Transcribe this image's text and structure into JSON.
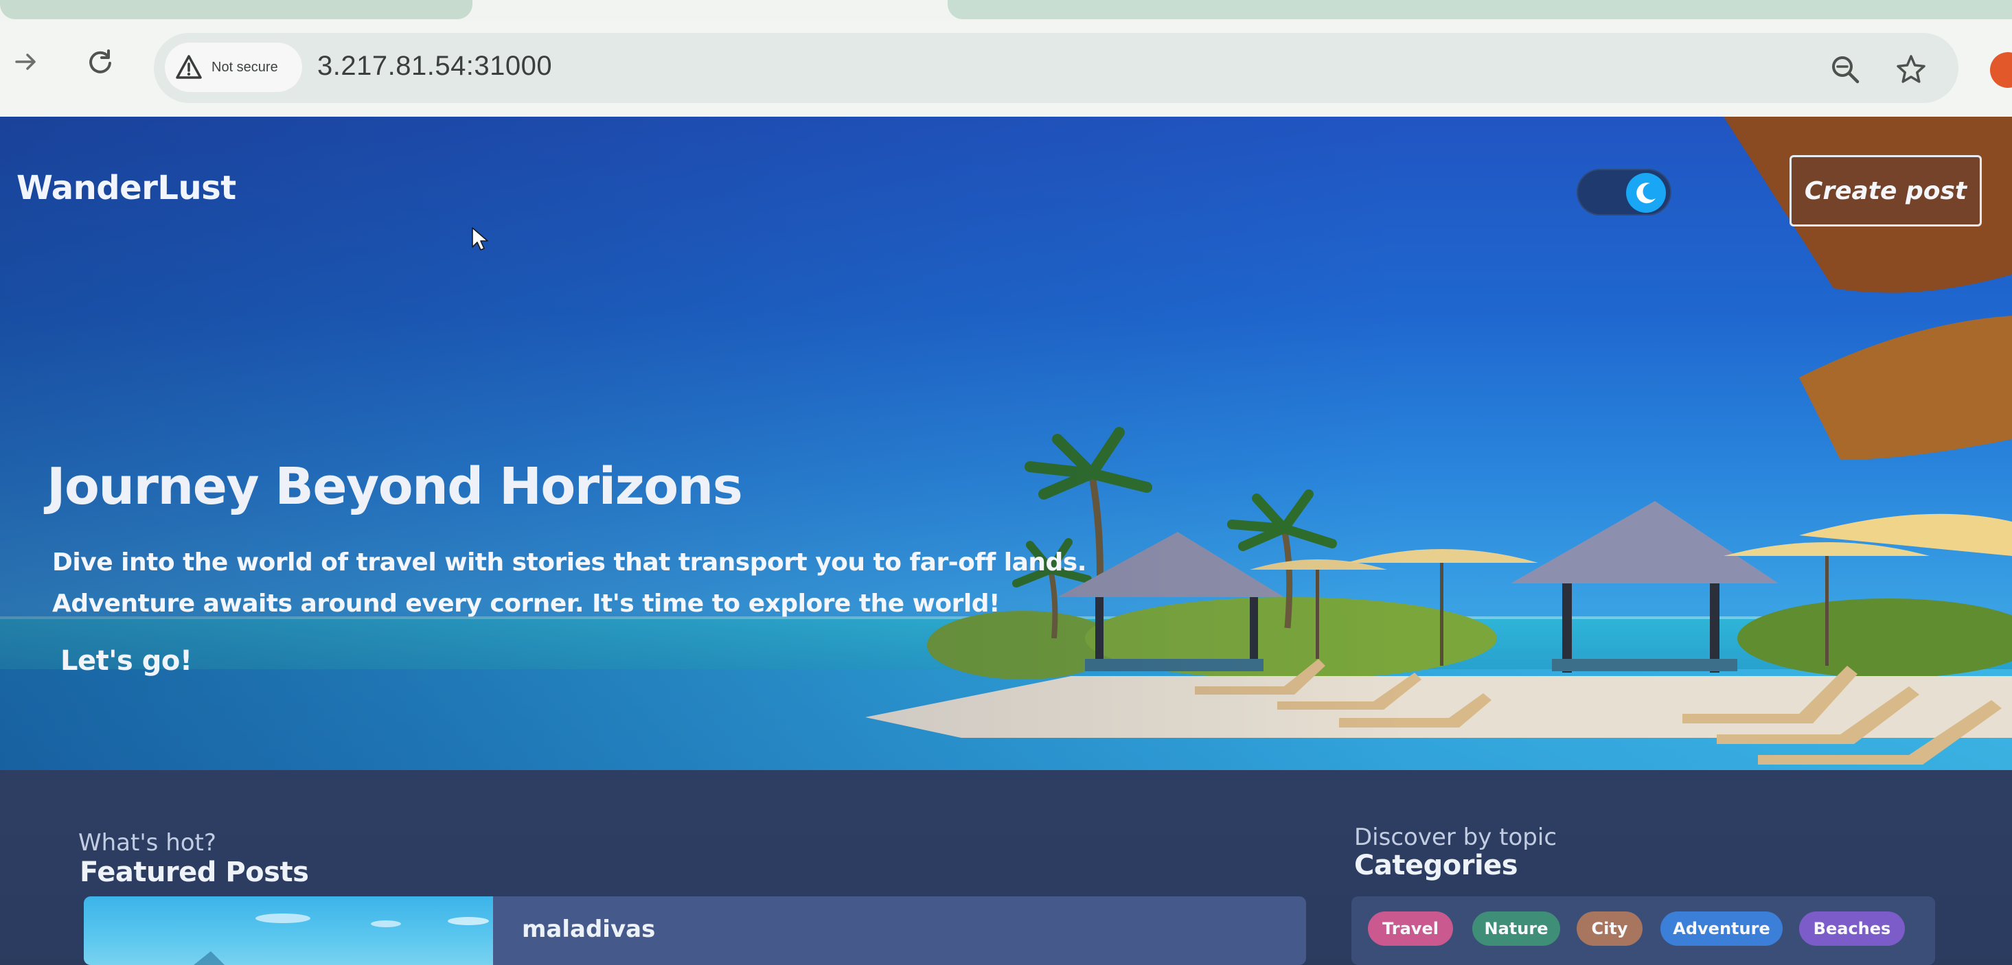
{
  "browser": {
    "security_label": "Not secure",
    "url": "3.217.81.54:31000",
    "icons": [
      "forward-arrow-icon",
      "reload-icon",
      "warning-icon",
      "zoom-icon",
      "bookmark-star-icon"
    ]
  },
  "header": {
    "brand": "WanderLust",
    "create_post_label": "Create post",
    "theme_toggle_icon": "moon-icon"
  },
  "hero": {
    "title": "Journey Beyond Horizons",
    "description": "Dive into the world of travel with stories that transport you to far-off lands. Adventure awaits around every corner. It's time to explore the world!",
    "cta": "Let's go!"
  },
  "featured": {
    "kicker": "What's hot?",
    "title": "Featured Posts",
    "posts": [
      {
        "title": "maladivas"
      }
    ]
  },
  "categories": {
    "kicker": "Discover by topic",
    "title": "Categories",
    "items": [
      {
        "label": "Travel",
        "color": "#c9598f"
      },
      {
        "label": "Nature",
        "color": "#3e8e78"
      },
      {
        "label": "City",
        "color": "#a8755f"
      },
      {
        "label": "Adventure",
        "color": "#3c7fd8"
      },
      {
        "label": "Beaches",
        "color": "#7c5cc8"
      }
    ]
  },
  "colors": {
    "hero_sky": "#2155c2",
    "content_bg": "#2d3e62",
    "toggle_knob": "#18a6f5"
  }
}
